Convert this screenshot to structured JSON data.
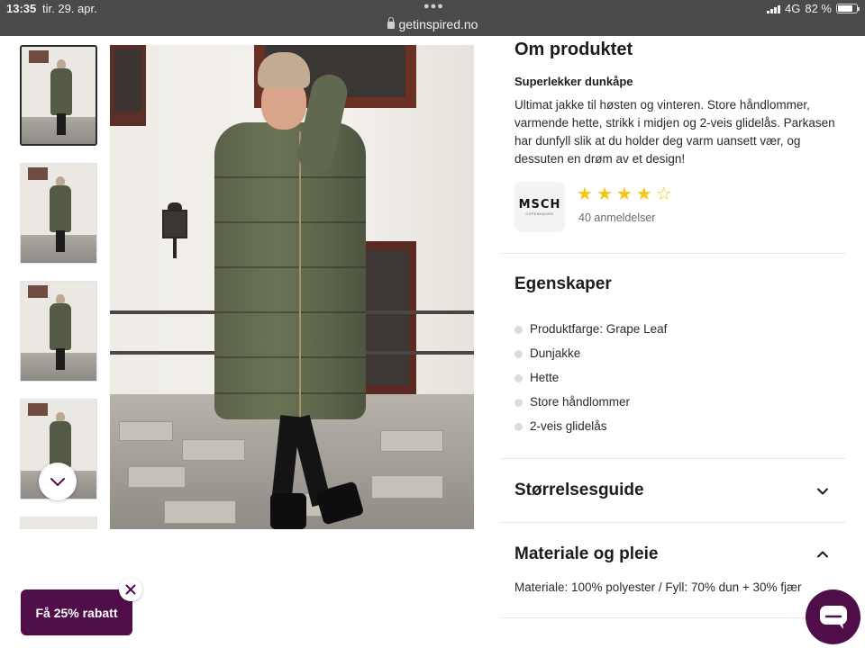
{
  "status_bar": {
    "time": "13:35",
    "date": "tir. 29. apr.",
    "url": "getinspired.no",
    "network": "4G",
    "battery": "82 %"
  },
  "gallery": {
    "thumbnail_count": 5,
    "selected_index": 0
  },
  "product": {
    "section_title": "Om produktet",
    "subtitle": "Superlekker dunkåpe",
    "description": "Ultimat jakke til høsten og vinteren. Store håndlommer, varmende hette, strikk i midjen og 2-veis glidelås. Parkasen har dunfyll slik at du holder deg varm uansett vær, og dessuten en drøm av et design!",
    "brand_logo_text": "MSCH",
    "brand_logo_subtext": "COPENHAGEN",
    "rating_stars": 4,
    "rating_max": 5,
    "reviews_text": "40 anmeldelser"
  },
  "properties": {
    "title": "Egenskaper",
    "items": [
      "Produktfarge: Grape Leaf",
      "Dunjakke",
      "Hette",
      "Store håndlommer",
      "2-veis glidelås"
    ]
  },
  "size_guide": {
    "title": "Størrelsesguide",
    "expanded": false
  },
  "material_care": {
    "title": "Materiale og pleie",
    "expanded": true,
    "text": "Materiale: 100% polyester / Fyll: 70% dun + 30% fjær"
  },
  "promo": {
    "label": "Få 25% rabatt"
  },
  "icons": {
    "scroll_down": "chevron-down-icon",
    "promo_close": "close-icon",
    "chat": "chat-bubble-icon",
    "lock": "lock-icon"
  },
  "colors": {
    "brand_purple": "#4f0d4a",
    "star_yellow": "#f5c518",
    "status_bar": "#4a4a4a"
  }
}
